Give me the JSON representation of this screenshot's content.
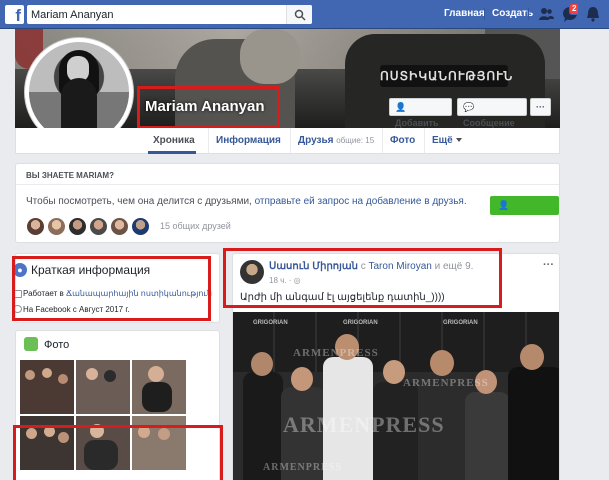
{
  "topbar": {
    "search_value": "Mariam Ananyan",
    "home_label": "Главная",
    "create_label": "Создать",
    "notifications_count": "2"
  },
  "profile": {
    "name": "Mariam Ananyan",
    "cover_patch_text": "ՈՍՏԻԿԱՆՈՒԹՅՈՒՆ",
    "add_friend_label": "Добавить",
    "message_label": "Сообщение",
    "more_label": "···"
  },
  "tabs": [
    {
      "label": "Хроника"
    },
    {
      "label": "Информация"
    },
    {
      "label": "Друзья",
      "extra": "общие: 15"
    },
    {
      "label": "Фото"
    },
    {
      "label": "Ещё"
    }
  ],
  "know": {
    "title": "ВЫ ЗНАЕТЕ MARIAM?",
    "text_before": "Чтобы посмотреть, чем она делится с друзьями, ",
    "text_link": "отправьте ей запрос на добавление в друзья.",
    "add_label": "Добавить",
    "mutual_count": "15 общих друзей"
  },
  "intro": {
    "title": "Краткая информация",
    "work_prefix": "Работает в ",
    "work_place": "Ճանապարհային ոստիկանություն",
    "joined": "На Facebook с Август 2017 г."
  },
  "photos": {
    "title": "Фото"
  },
  "post": {
    "author": "Սասուն Միրոյան",
    "with_text": " с ",
    "with_person": "Taron Miroyan",
    "and_others": " и ещё 9.",
    "time": "18 ч. · ",
    "text": "Արժի մի անգամ էլ այցելենք դատին_))))",
    "more": "···",
    "watermark": "ARMENPRESS"
  },
  "colors": {
    "brand": "#4267b2",
    "link": "#365899",
    "green": "#42b72a",
    "highlight": "#d81c1c"
  }
}
